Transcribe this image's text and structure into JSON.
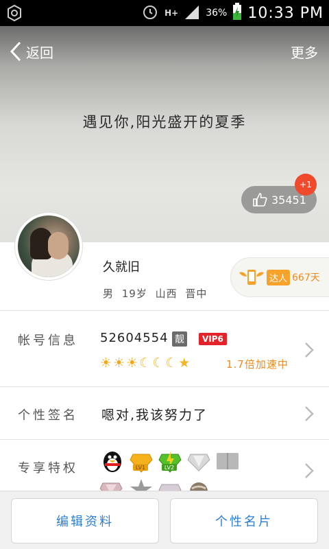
{
  "status_bar": {
    "network": "H+",
    "battery": "36%",
    "time": "10:33 PM"
  },
  "nav": {
    "back": "返回",
    "more": "更多"
  },
  "cover": {
    "motto": "遇见你,阳光盛开的夏季",
    "likes": "35451",
    "like_increment": "+1"
  },
  "profile": {
    "nickname": "久就旧",
    "info": "男 19岁 山西 晋中",
    "talent_label": "达人",
    "talent_days": "667天"
  },
  "account": {
    "label": "帐号信息",
    "number": "52604554",
    "liang_badge": "靓",
    "vip_badge": "VIP6",
    "level_icons": [
      "sun",
      "sun",
      "sun",
      "moon",
      "moon",
      "moon",
      "star"
    ],
    "speed": "1.7倍加速中"
  },
  "signature": {
    "label": "个性签名",
    "text": "嗯对,我该努力了"
  },
  "privileges": {
    "label": "专享特权",
    "icons": [
      "qq-penguin-icon",
      "gold-diamond-lv1-icon",
      "green-diamond-lv2-icon",
      "silver-diamond-icon",
      "gray-card-icon",
      "pink-diamond-icon",
      "gray-star-icon",
      "diamond-icon",
      "ball-icon"
    ],
    "lv1": "LV1",
    "lv2": "LV2",
    "pink_num": "1"
  },
  "bottom_bar": {
    "edit_profile": "编辑资料",
    "personal_card": "个性名片"
  },
  "colors": {
    "accent_blue": "#2a7fd4",
    "badge_red": "#ee4a2b",
    "orange": "#f08a18"
  }
}
